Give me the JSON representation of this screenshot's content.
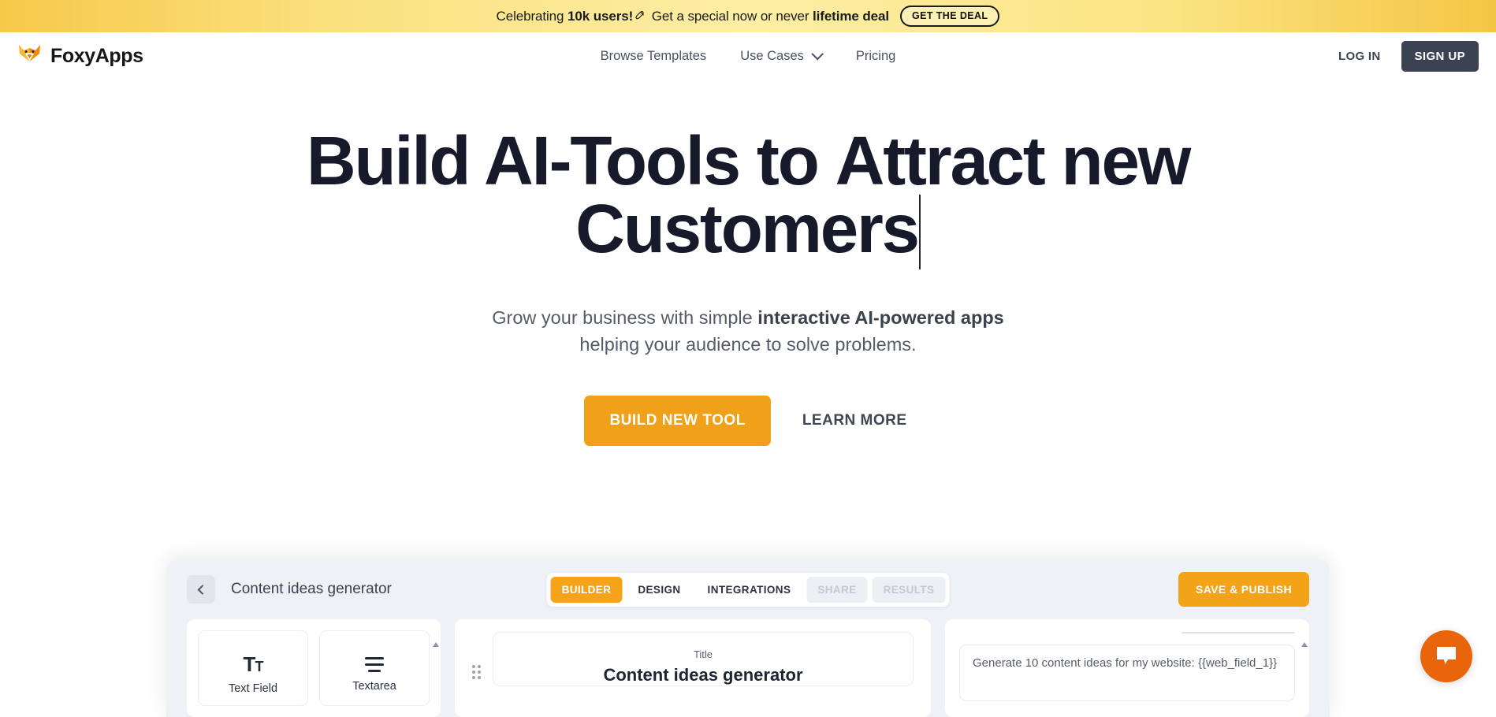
{
  "promo": {
    "text_before": "Celebrating ",
    "text_bold": "10k users!",
    "icon": "rocket-icon",
    "text_middle": " Get a special now or never ",
    "text_bold2": "lifetime deal",
    "button_label": "GET THE DEAL"
  },
  "header": {
    "logo_icon": "fox-logo-icon",
    "brand": "FoxyApps",
    "nav": [
      {
        "label": "Browse Templates",
        "has_chevron": false
      },
      {
        "label": "Use Cases",
        "has_chevron": true
      },
      {
        "label": "Pricing",
        "has_chevron": false
      }
    ],
    "login_label": "LOG IN",
    "signup_label": "SIGN UP"
  },
  "hero": {
    "title_part1": "Build AI-Tools to ",
    "title_highlight1": "Attract new",
    "title_highlight2": "Customers",
    "sub_part1": "Grow your business with simple ",
    "sub_bold": "interactive AI-powered apps",
    "sub_part2": " helping your audience to solve problems.",
    "cta_primary": "BUILD NEW TOOL",
    "cta_secondary": "LEARN MORE"
  },
  "app_preview": {
    "back_icon": "chevron-left-icon",
    "title": "Content ideas generator",
    "tabs": [
      {
        "label": "BUILDER",
        "state": "active"
      },
      {
        "label": "DESIGN",
        "state": "default"
      },
      {
        "label": "INTEGRATIONS",
        "state": "default"
      },
      {
        "label": "SHARE",
        "state": "disabled"
      },
      {
        "label": "RESULTS",
        "state": "disabled"
      }
    ],
    "publish_label": "SAVE & PUBLISH",
    "widgets": [
      {
        "label": "Text Field",
        "icon": "text-field-icon"
      },
      {
        "label": "Textarea",
        "icon": "textarea-icon"
      }
    ],
    "form": {
      "title_label": "Title",
      "title_value": "Content ideas generator"
    },
    "prompt_value": "Generate 10 content ideas for my website: {{web_field_1}}"
  },
  "chat": {
    "icon": "chat-bubble-icon",
    "aria": "Open chat"
  },
  "colors": {
    "accent_yellow": "#f8c20c",
    "accent_orange": "#f0a019",
    "dark": "#161a2b",
    "chat_orange": "#e8650b"
  }
}
